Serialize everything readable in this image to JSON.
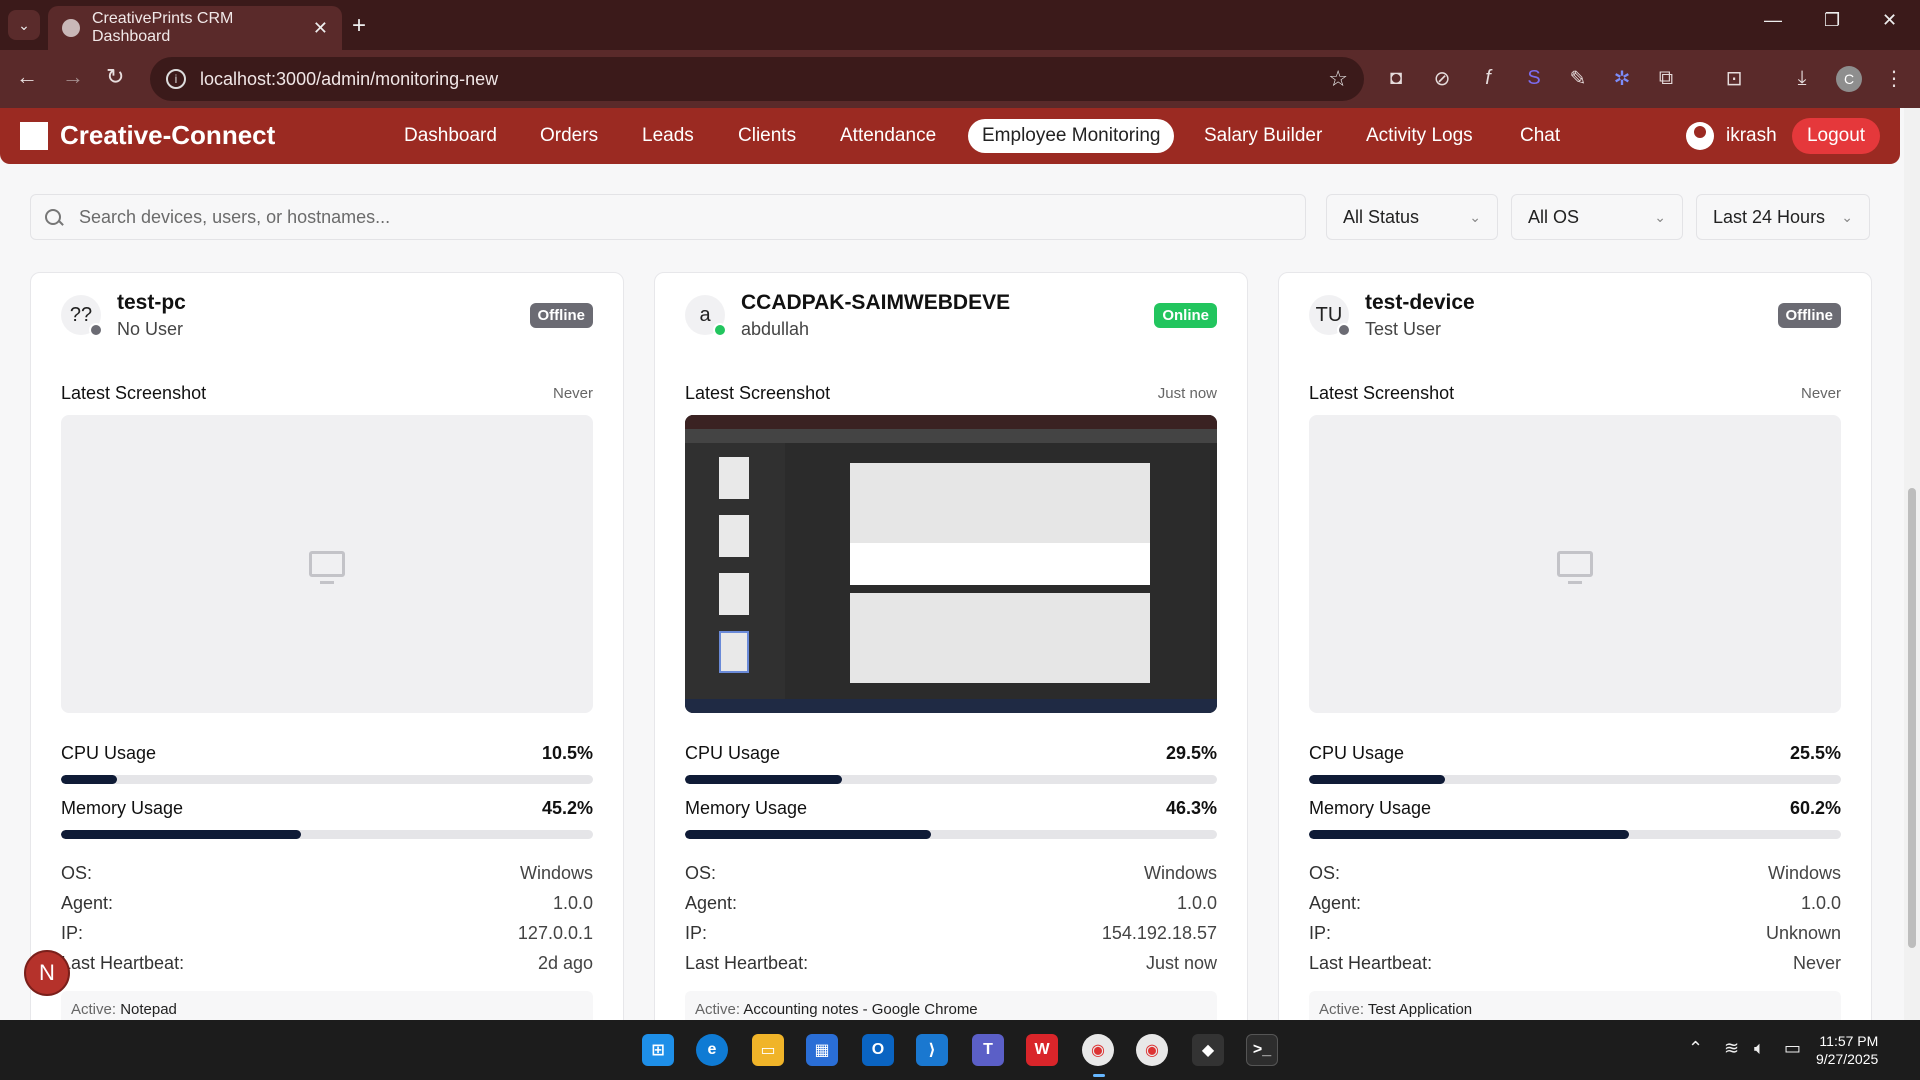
{
  "browser": {
    "tab_title": "CreativePrints CRM Dashboard",
    "url": "localhost:3000/admin/monitoring-new",
    "profile_initial": "C"
  },
  "nav": {
    "brand": "Creative-Connect",
    "links": [
      "Dashboard",
      "Orders",
      "Leads",
      "Clients",
      "Attendance",
      "Employee Monitoring",
      "Salary Builder",
      "Activity Logs",
      "Chat"
    ],
    "active": "Employee Monitoring",
    "user": "ikrash",
    "logout": "Logout"
  },
  "filters": {
    "search_placeholder": "Search devices, users, or hostnames...",
    "status": "All Status",
    "os": "All OS",
    "range": "Last 24 Hours"
  },
  "labels": {
    "latest_screenshot": "Latest Screenshot",
    "cpu": "CPU Usage",
    "memory": "Memory Usage",
    "os": "OS:",
    "agent": "Agent:",
    "ip": "IP:",
    "heartbeat": "Last Heartbeat:",
    "active": "Active:"
  },
  "devices": [
    {
      "initials": "??",
      "name": "test-pc",
      "user": "No User",
      "status": "Offline",
      "screenshot_time": "Never",
      "cpu": "10.5%",
      "cpu_pct": 10.5,
      "mem": "45.2%",
      "mem_pct": 45.2,
      "os": "Windows",
      "agent": "1.0.0",
      "ip": "127.0.0.1",
      "heartbeat": "2d ago",
      "active_app": "Notepad"
    },
    {
      "initials": "a",
      "name": "CCADPAK-SAIMWEBDEVE",
      "user": "abdullah",
      "status": "Online",
      "screenshot_time": "Just now",
      "cpu": "29.5%",
      "cpu_pct": 29.5,
      "mem": "46.3%",
      "mem_pct": 46.3,
      "os": "Windows",
      "agent": "1.0.0",
      "ip": "154.192.18.57",
      "heartbeat": "Just now",
      "active_app": "Accounting notes - Google Chrome"
    },
    {
      "initials": "TU",
      "name": "test-device",
      "user": "Test User",
      "status": "Offline",
      "screenshot_time": "Never",
      "cpu": "25.5%",
      "cpu_pct": 25.5,
      "mem": "60.2%",
      "mem_pct": 60.2,
      "os": "Windows",
      "agent": "1.0.0",
      "ip": "Unknown",
      "heartbeat": "Never",
      "active_app": "Test Application"
    }
  ],
  "fab_initial": "N",
  "clock": {
    "time": "11:57 PM",
    "date": "9/27/2025"
  },
  "colors": {
    "nav": "#9b2a22",
    "online": "#22c55e",
    "offline": "#6b6b73",
    "bar_fill": "#0f1b36",
    "logout": "#e5383b"
  }
}
